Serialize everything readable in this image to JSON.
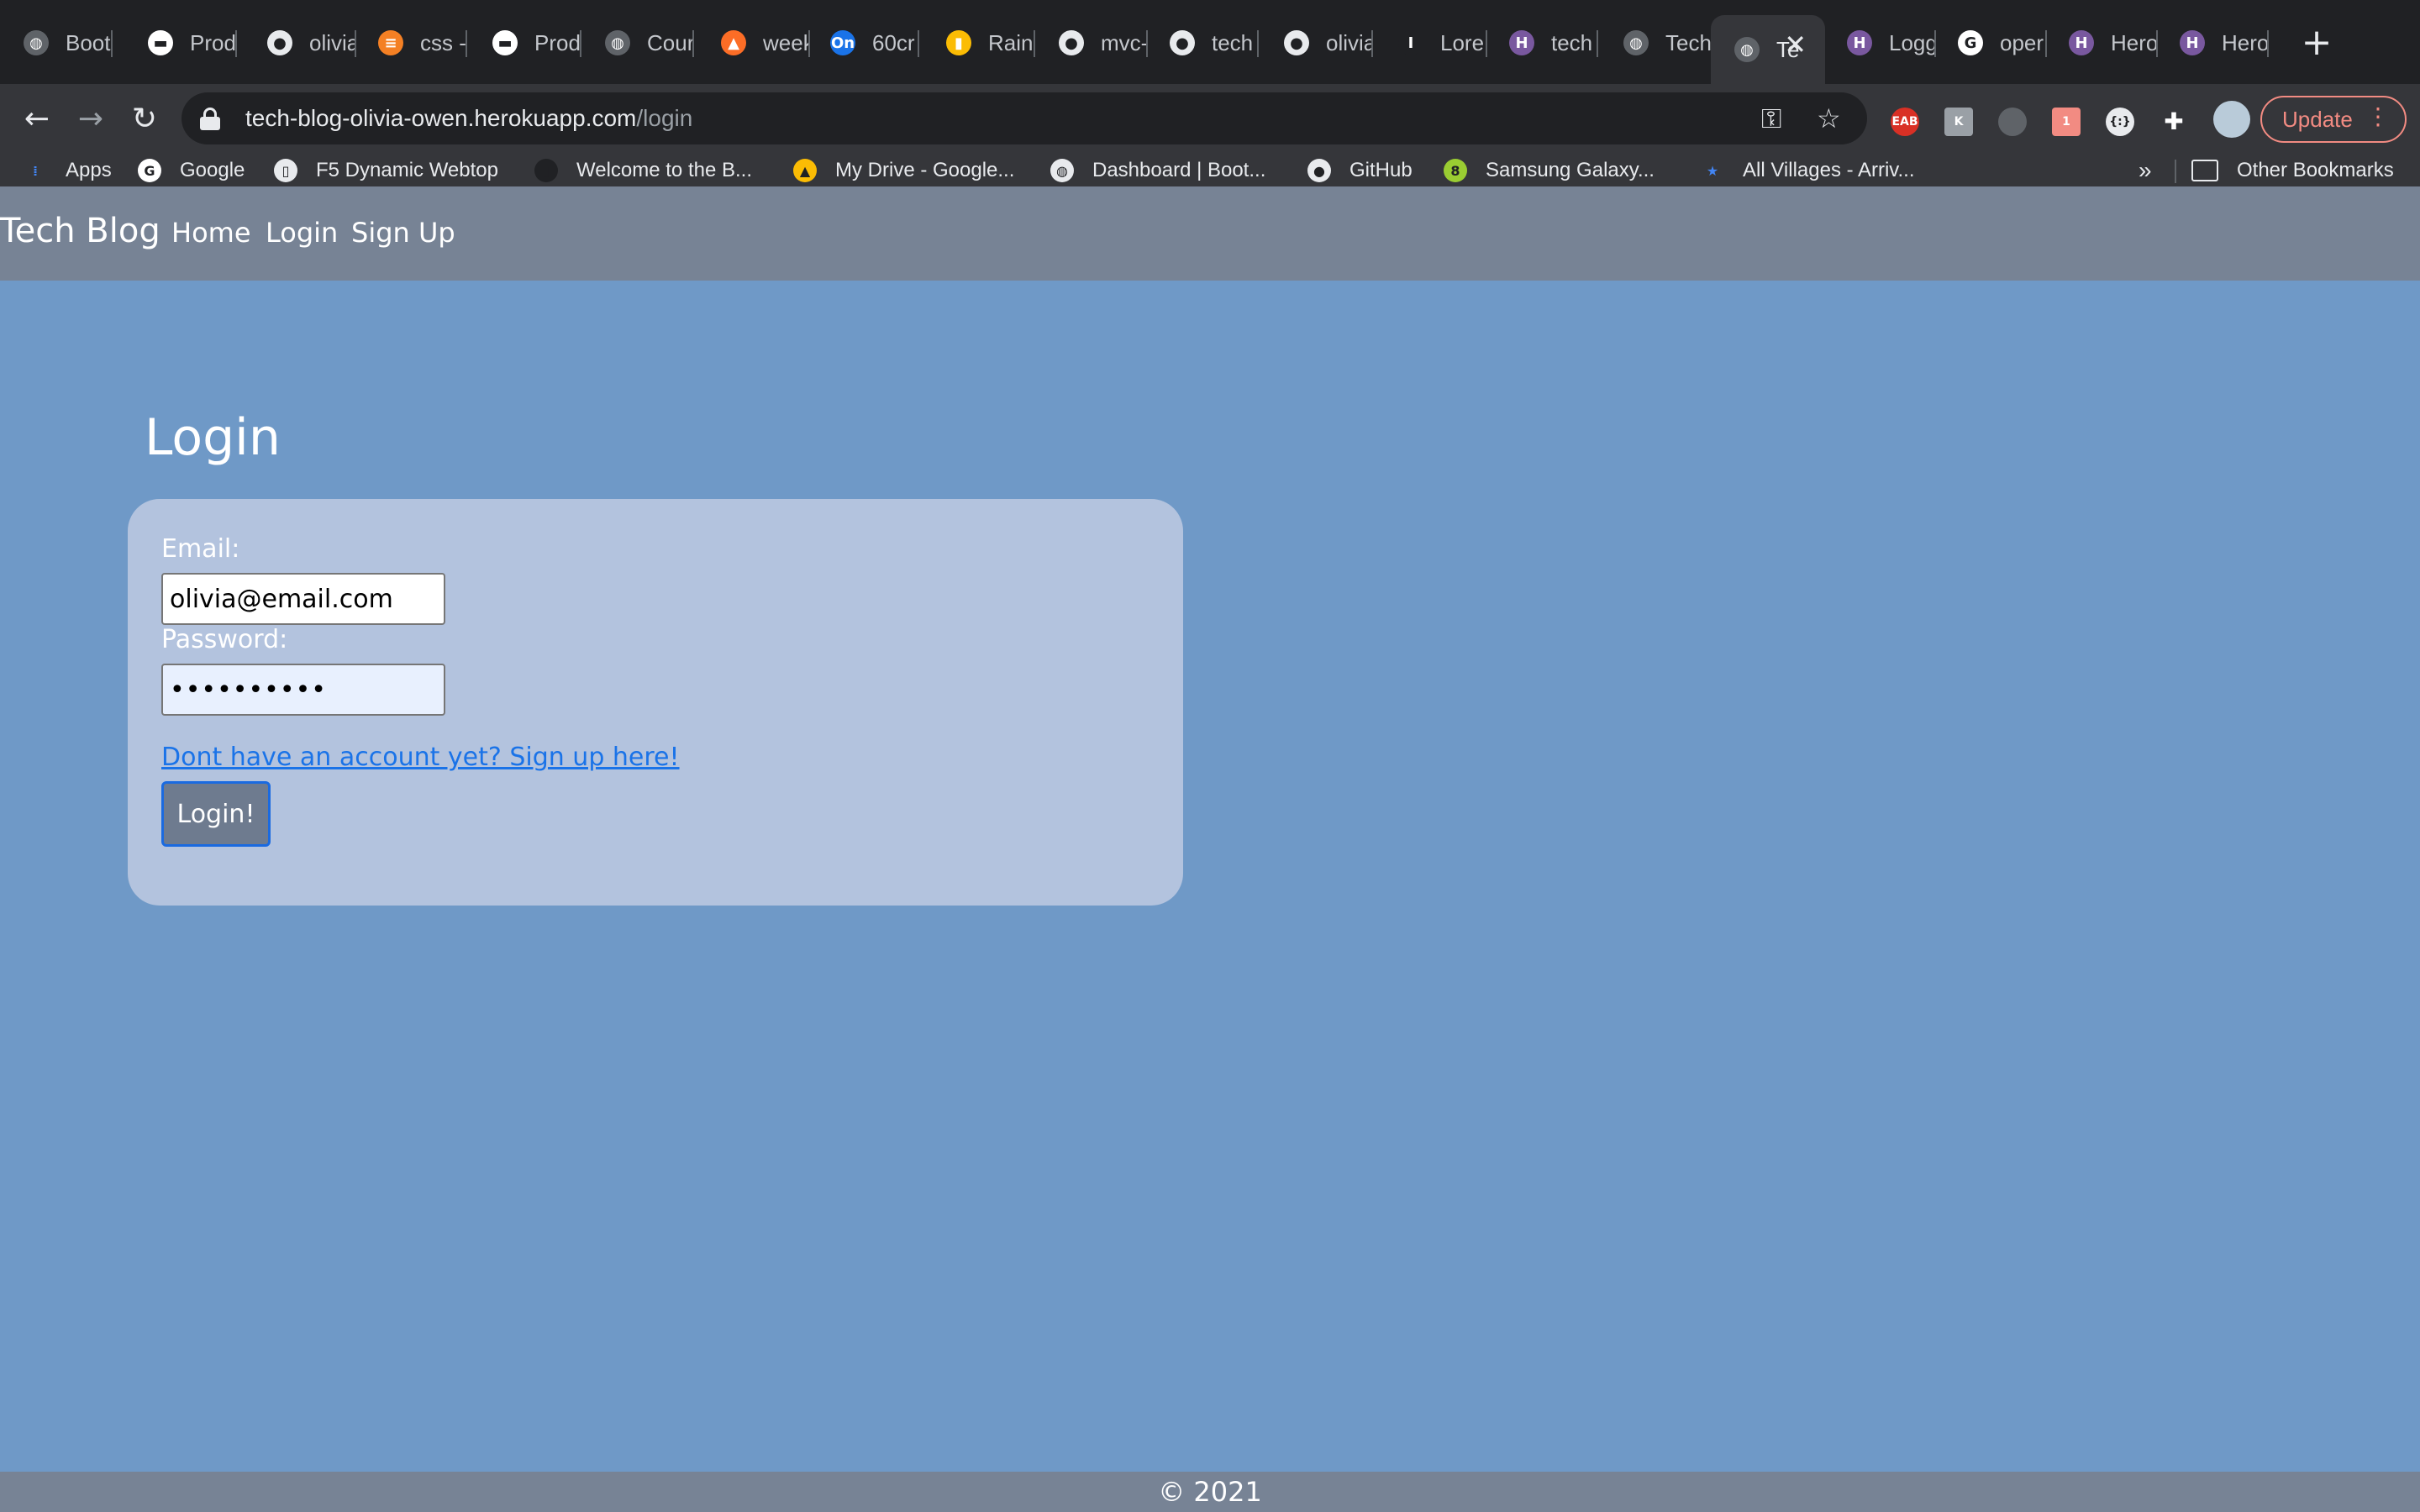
{
  "browser": {
    "tabs": [
      {
        "label": "Boot",
        "icon": "globe-icon",
        "color": "#5f6368"
      },
      {
        "label": "Prod",
        "icon": "product-icon",
        "color": "#ffffff"
      },
      {
        "label": "olivia",
        "icon": "github-icon",
        "color": "#e8eaed"
      },
      {
        "label": "css -",
        "icon": "stackoverflow-icon",
        "color": "#f48024"
      },
      {
        "label": "Prod",
        "icon": "product-icon",
        "color": "#ffffff"
      },
      {
        "label": "Cour",
        "icon": "globe-icon",
        "color": "#5f6368"
      },
      {
        "label": "week",
        "icon": "gitlab-icon",
        "color": "#fc6d26"
      },
      {
        "label": "60cr",
        "icon": "on-icon",
        "color": "#1a73e8"
      },
      {
        "label": "Rain",
        "icon": "rainbow-icon",
        "color": "#fbbc04"
      },
      {
        "label": "mvc-",
        "icon": "github-icon",
        "color": "#e8eaed"
      },
      {
        "label": "tech",
        "icon": "github-icon",
        "color": "#e8eaed"
      },
      {
        "label": "olivia",
        "icon": "github-icon",
        "color": "#e8eaed"
      },
      {
        "label": "Lore",
        "icon": "lorem-icon",
        "color": "#202124"
      },
      {
        "label": "tech",
        "icon": "heroku-icon",
        "color": "#79589f"
      },
      {
        "label": "Tech",
        "icon": "globe-icon",
        "color": "#5f6368"
      },
      {
        "label": "Te",
        "icon": "globe-icon",
        "color": "#5f6368",
        "active": true
      },
      {
        "label": "Logg",
        "icon": "heroku-icon",
        "color": "#79589f"
      },
      {
        "label": "oper",
        "icon": "google-icon",
        "color": "#ffffff"
      },
      {
        "label": "Hero",
        "icon": "heroku-icon",
        "color": "#79589f"
      },
      {
        "label": "Hero",
        "icon": "heroku-icon",
        "color": "#79589f"
      }
    ],
    "url_host": "tech-blog-olivia-owen.herokuapp.com",
    "url_path": "/login",
    "update_label": "Update",
    "bookmarks": [
      {
        "label": "Apps",
        "icon": "apps-grid-icon",
        "color": "#4285f4"
      },
      {
        "label": "Google",
        "icon": "google-icon",
        "color": "#ffffff"
      },
      {
        "label": "F5 Dynamic Webtop",
        "icon": "document-icon",
        "color": "#e8eaed"
      },
      {
        "label": "Welcome to the B...",
        "icon": "book-icon",
        "color": "#202124"
      },
      {
        "label": "My Drive - Google...",
        "icon": "drive-icon",
        "color": "#fbbc04"
      },
      {
        "label": "Dashboard | Boot...",
        "icon": "globe-icon",
        "color": "#e8eaed"
      },
      {
        "label": "GitHub",
        "icon": "github-icon",
        "color": "#e8eaed"
      },
      {
        "label": "Samsung Galaxy...",
        "icon": "samsung-icon",
        "color": "#9acd32"
      },
      {
        "label": "All Villages - Arriv...",
        "icon": "star-icon",
        "color": "#4285f4"
      }
    ],
    "other_bookmarks": "Other Bookmarks",
    "more_bookmarks": "»"
  },
  "site": {
    "brand": "Tech Blog",
    "nav": {
      "home": "Home",
      "login": "Login",
      "signup": "Sign Up"
    }
  },
  "login": {
    "title": "Login",
    "email_label": "Email:",
    "email_value": "olivia@email.com",
    "password_label": "Password:",
    "password_value": "••••••••••",
    "signup_link": "Dont have an account yet? Sign up here!",
    "submit": "Login!"
  },
  "footer": {
    "copyright": "© 2021"
  },
  "colors": {
    "page_bg": "#6f99c7",
    "nav_bg": "#778395",
    "card_bg": "#b3c3de",
    "link": "#1a73e8"
  }
}
